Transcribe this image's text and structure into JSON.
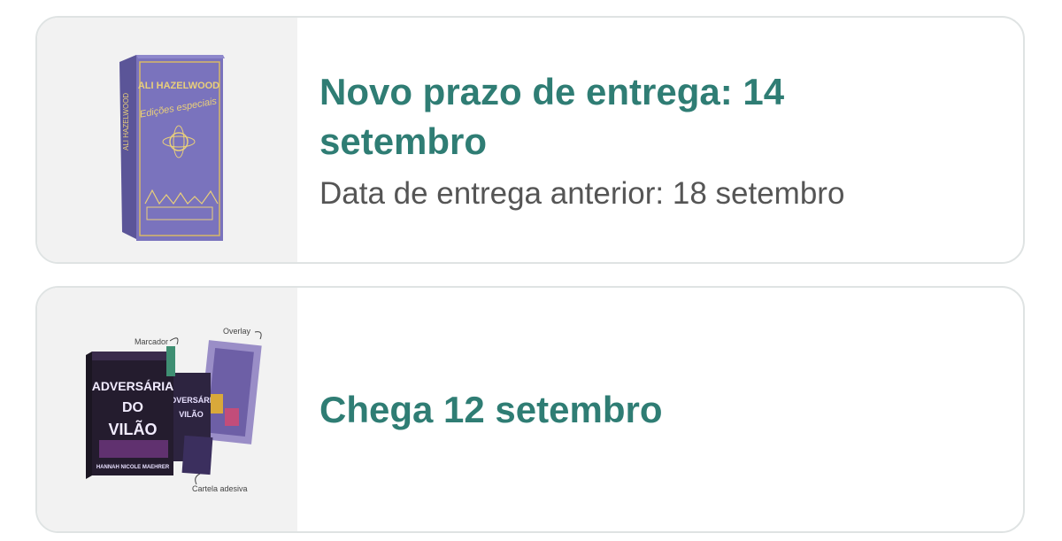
{
  "deliveries": [
    {
      "image_icon": "book-box-set-image",
      "cover_author": "ALI HAZELWOOD",
      "headline": "Novo prazo de entrega: 14 setembro",
      "previous_date": "Data de entrega anterior: 18 setembro"
    },
    {
      "image_icon": "book-kit-image",
      "cover_title_line1": "ADVERSÁRIA",
      "cover_title_line2": "DO",
      "cover_title_line3": "VILÃO",
      "cover_author": "HANNAH NICOLE MAEHRER",
      "callout_marker": "Marcador",
      "callout_overlay": "Overlay",
      "callout_sticker": "Cartela adesiva",
      "headline": "Chega 12 setembro"
    }
  ],
  "colors": {
    "headline": "#2f7d74",
    "subtext": "#555555",
    "card_border": "#dfe3e3",
    "thumb_bg": "#f2f2f2"
  }
}
